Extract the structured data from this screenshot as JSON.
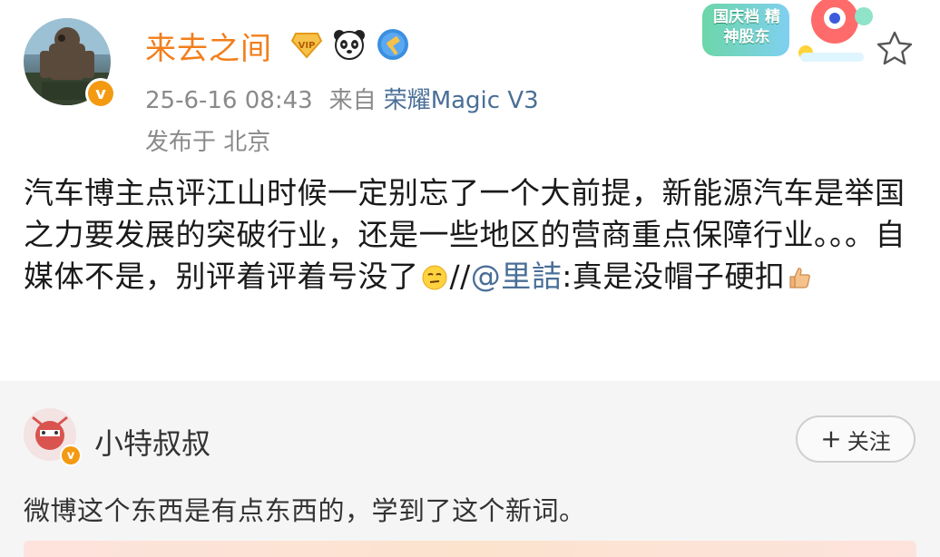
{
  "post": {
    "author": "来去之间",
    "badges": [
      "vip-badge-icon",
      "panda-icon",
      "shield-hammer-icon"
    ],
    "date": "25-6-16 08:43",
    "source_label": "来自",
    "device": "荣耀Magic V3",
    "location": "发布于 北京",
    "promo_text": "国庆档 精神股东",
    "text_part1": "汽车博主点评江山时候一定别忘了一个大前提，新能源汽车是举国之力要发展的突破行业，还是一些地区的营商重点保障行业。。。自媒体不是，别评着评着号没了",
    "text_part2": "//",
    "mention": "@里詰",
    "text_part3": ":真是没帽子硬扣",
    "verified_mark": "v"
  },
  "repost": {
    "author": "小特叔叔",
    "follow_label": "关注",
    "follow_plus": "+",
    "text": "微博这个东西是有点东西的，学到了这个新词。",
    "verified_mark": "v"
  },
  "colors": {
    "username": "#f27e1b",
    "link": "#4a6f97",
    "meta": "#8a8a8a",
    "repost_bg": "#f5f5f5",
    "verified": "#f39a12"
  }
}
